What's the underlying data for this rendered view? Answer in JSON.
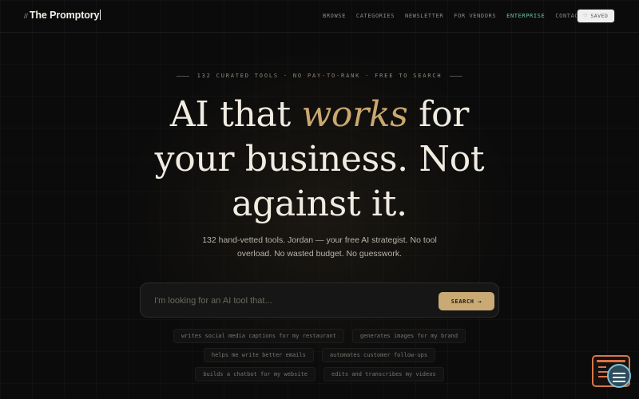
{
  "brand": {
    "slashes": "//",
    "name": "The Promptory"
  },
  "nav": {
    "links": [
      "BROWSE",
      "CATEGORIES",
      "NEWSLETTER",
      "FOR VENDORS",
      "ENTERPRISE",
      "CONTACT"
    ],
    "accent_link": "ENTERPRISE",
    "saved_label": "SAVED"
  },
  "hero": {
    "eyebrow": "132 CURATED TOOLS · NO PAY-TO-RANK · FREE TO SEARCH",
    "headline_line1_pre": "AI that ",
    "headline_line1_em": "works",
    "headline_line1_post": " for",
    "headline_line2": "your business. Not",
    "headline_line3": "against it.",
    "subtext": "132 hand-vetted tools. Jordan — your free AI strategist. No tool overload. No wasted budget. No guesswork."
  },
  "search": {
    "placeholder": "I'm looking for an AI tool that...",
    "value": "",
    "button_label": "SEARCH →"
  },
  "suggestions": [
    [
      "writes social media captions for my restaurant",
      "generates images for my brand"
    ],
    [
      "helps me write better emails",
      "automates customer follow-ups"
    ],
    [
      "builds a chatbot for my website",
      "edits and transcribes my videos"
    ]
  ],
  "colors": {
    "background": "#0b0b0b",
    "accent_gold": "#c9a86f",
    "accent_teal": "#6fbfa8",
    "widget_orange": "#d9764a"
  },
  "icons": {
    "saved": "heart-icon",
    "widget": "chat-widget-icon"
  }
}
